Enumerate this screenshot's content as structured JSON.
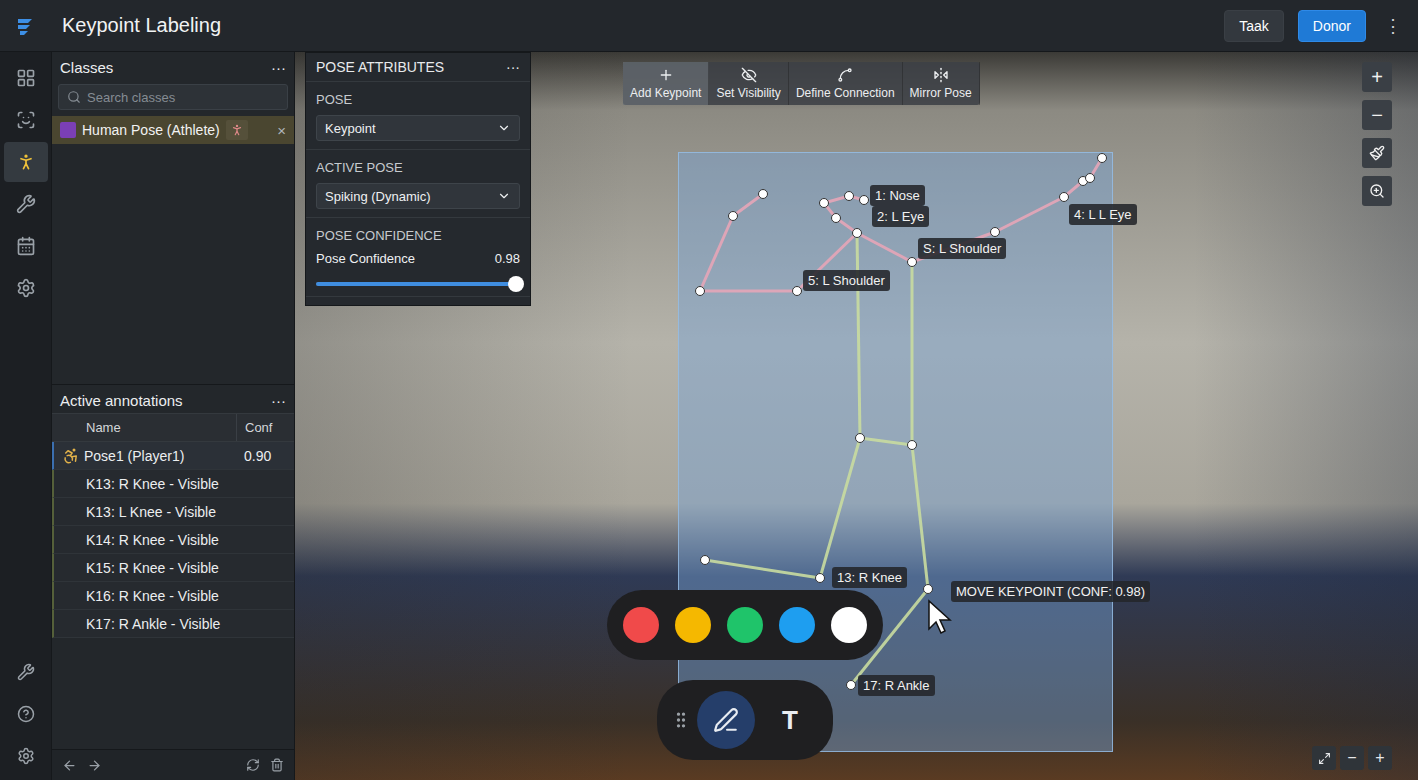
{
  "app": {
    "title": "Keypoint Labeling",
    "buttons": [
      {
        "label": "Taak",
        "primary": false
      },
      {
        "label": "Donor",
        "primary": true
      }
    ],
    "menu": "⋮"
  },
  "rail": [
    {
      "selected": false
    },
    {
      "selected": false
    },
    {
      "selected": true
    },
    {
      "selected": false
    },
    {
      "selected": false
    },
    {
      "selected": false
    },
    {
      "selected": false
    },
    {
      "selected": false
    },
    {
      "selected": false
    }
  ],
  "classes": {
    "title": "Classes",
    "menu": "···",
    "search": {
      "placeholder": "Search classes"
    },
    "items": [
      {
        "label": "Human Pose (Athlete)",
        "color": "#7b3fb5",
        "selected": true,
        "remove": "×"
      }
    ]
  },
  "pose_attributes": {
    "title": "POSE ATTRIBUTES",
    "menu": "···",
    "fields": [
      {
        "label": "POSE",
        "value": "Keypoint"
      },
      {
        "label": "ACTIVE POSE",
        "value": "Spiking (Dynamic)"
      }
    ],
    "confidence": {
      "section": "POSE CONFIDENCE",
      "label": "Pose Confidence",
      "reading": "0.98",
      "level": 0.98
    }
  },
  "annotations": {
    "title": "Active annotations",
    "menu": "···",
    "columns": [
      "Name",
      "Conf"
    ],
    "rows": [
      {
        "name": "Pose1 (Player1)",
        "conf": "0.90",
        "kind": "pose",
        "selected": true
      },
      {
        "name": "K13: R Knee - Visible",
        "kind": "keypoint",
        "selected": false
      },
      {
        "name": "K13: L Knee - Visible",
        "kind": "keypoint",
        "selected": false
      },
      {
        "name": "K14: R Knee - Visible",
        "kind": "keypoint",
        "selected": false
      },
      {
        "name": "K15: R Knee - Visible",
        "kind": "keypoint",
        "selected": false
      },
      {
        "name": "K16: R Knee - Visible",
        "kind": "keypoint",
        "selected": false
      },
      {
        "name": "K17: R Ankle - Visible",
        "kind": "keypoint",
        "selected": false
      }
    ]
  },
  "toolbar": [
    {
      "label": "Add Keypoint",
      "selected": true
    },
    {
      "label": "Set Visibility",
      "selected": false
    },
    {
      "label": "Define Connection",
      "selected": false
    },
    {
      "label": "Mirror Pose",
      "selected": false
    }
  ],
  "view_tools": {
    "zoom_in": "+",
    "zoom_out": "−"
  },
  "zoom_bar": {
    "zoom_out": "−",
    "zoom_in": "+"
  },
  "keypoints": [
    {
      "label": "1: Nose"
    },
    {
      "label": "2: L Eye"
    },
    {
      "label": "4: L L Eye"
    },
    {
      "label": "S: L Shoulder"
    },
    {
      "label": "5: L Shoulder"
    },
    {
      "label": "13: R Knee"
    },
    {
      "label": "MOVE KEYPOINT (CONF: 0.98)"
    },
    {
      "label": "17: R Ankle"
    }
  ],
  "palette": [
    {
      "color": "#f04a4a",
      "selected": false
    },
    {
      "color": "#f5b800",
      "selected": false
    },
    {
      "color": "#1fc46a",
      "selected": false
    },
    {
      "color": "#1e9ef0",
      "selected": false
    },
    {
      "color": "#ffffff",
      "selected": false
    }
  ],
  "draw_tools": [
    {
      "kind": "draw",
      "selected": true
    },
    {
      "kind": "text",
      "glyph": "T",
      "selected": false
    }
  ]
}
